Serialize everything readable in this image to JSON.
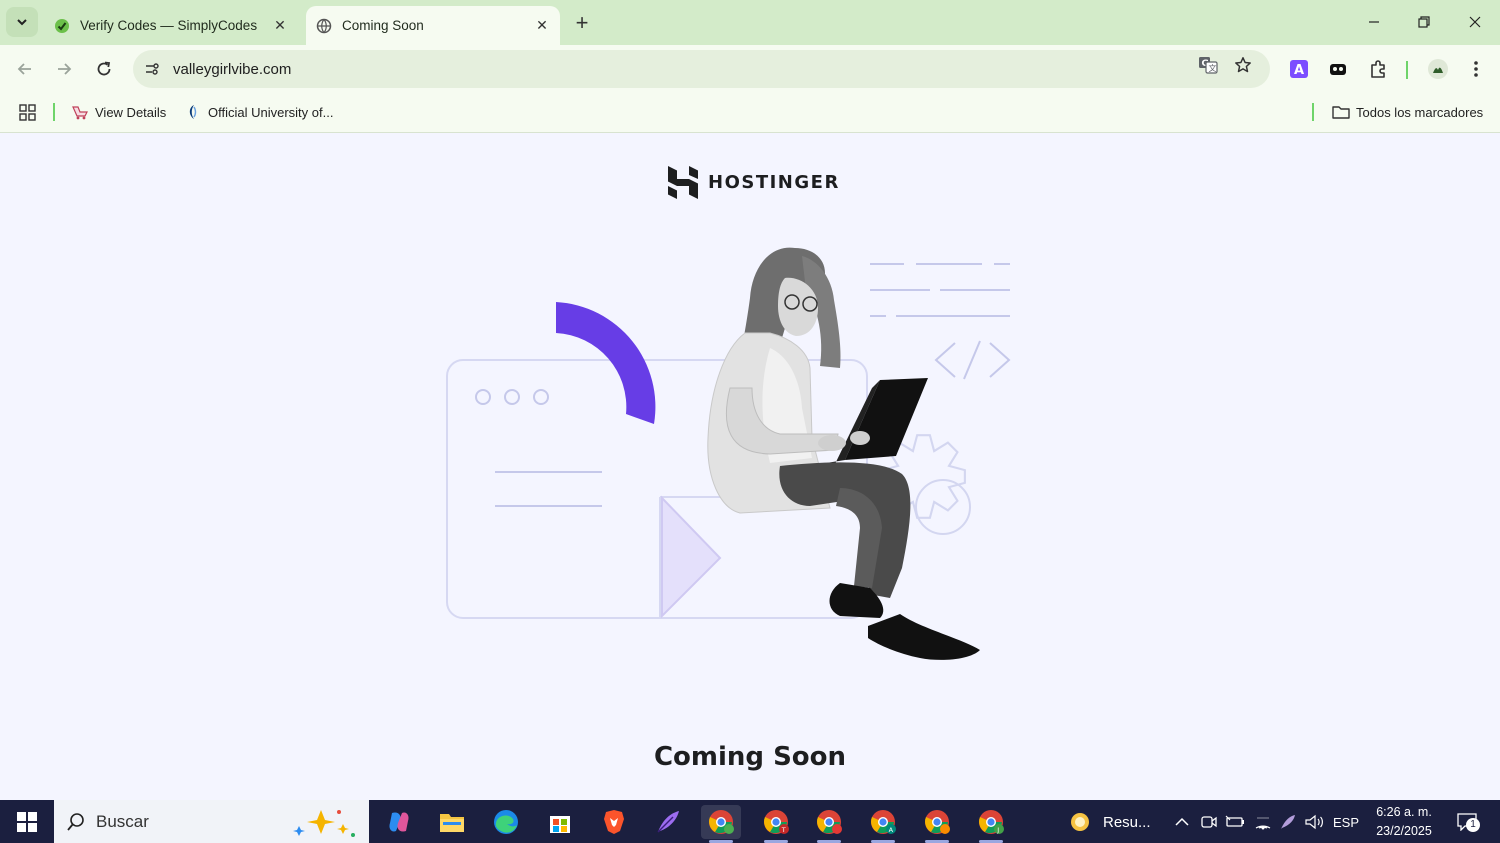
{
  "browser": {
    "tabs": [
      {
        "title": "Verify Codes — SimplyCodes",
        "active": false,
        "favicon": "simplycodes-icon"
      },
      {
        "title": "Coming Soon",
        "active": true,
        "favicon": "globe-icon"
      }
    ],
    "address": "valleygirlvibe.com",
    "bookmarks": [
      {
        "label": "View Details",
        "icon": "view-details-icon"
      },
      {
        "label": "Official University of...",
        "icon": "university-icon"
      }
    ],
    "all_bookmarks": "Todos los marcadores"
  },
  "page": {
    "brand": "HOSTINGER",
    "headline": "Coming Soon",
    "accent_color": "#673de6"
  },
  "taskbar": {
    "search_placeholder": "Buscar",
    "weather_label": "Resu...",
    "language": "ESP",
    "time": "6:26 a. m.",
    "date": "23/2/2025",
    "notification_count": "1"
  }
}
